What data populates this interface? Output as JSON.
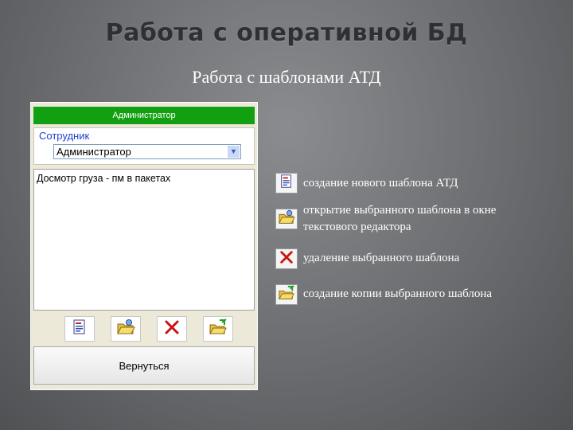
{
  "slide": {
    "title": "Работа с оперативной БД",
    "subtitle": "Работа с шаблонами АТД"
  },
  "dialog": {
    "header": "Администратор",
    "employee_label": "Сотрудник",
    "employee_selected": "Администратор",
    "templates": [
      "Досмотр груза - пм в пакетах"
    ],
    "toolbar": [
      {
        "icon": "new-template-icon"
      },
      {
        "icon": "open-template-icon"
      },
      {
        "icon": "delete-template-icon"
      },
      {
        "icon": "copy-template-icon"
      }
    ],
    "return_label": "Вернуться"
  },
  "legend": [
    {
      "icon": "new-template-icon",
      "text": "создание нового шаблона АТД"
    },
    {
      "icon": "open-template-icon",
      "text": "открытие выбранного шаблона в окне текстового редактора"
    },
    {
      "icon": "delete-template-icon",
      "text": "удаление выбранного шаблона"
    },
    {
      "icon": "copy-template-icon",
      "text": "создание копии выбранного шаблона"
    }
  ],
  "colors": {
    "header_green": "#12a012",
    "label_blue": "#1f3fcf",
    "delete_red": "#cc1111"
  }
}
